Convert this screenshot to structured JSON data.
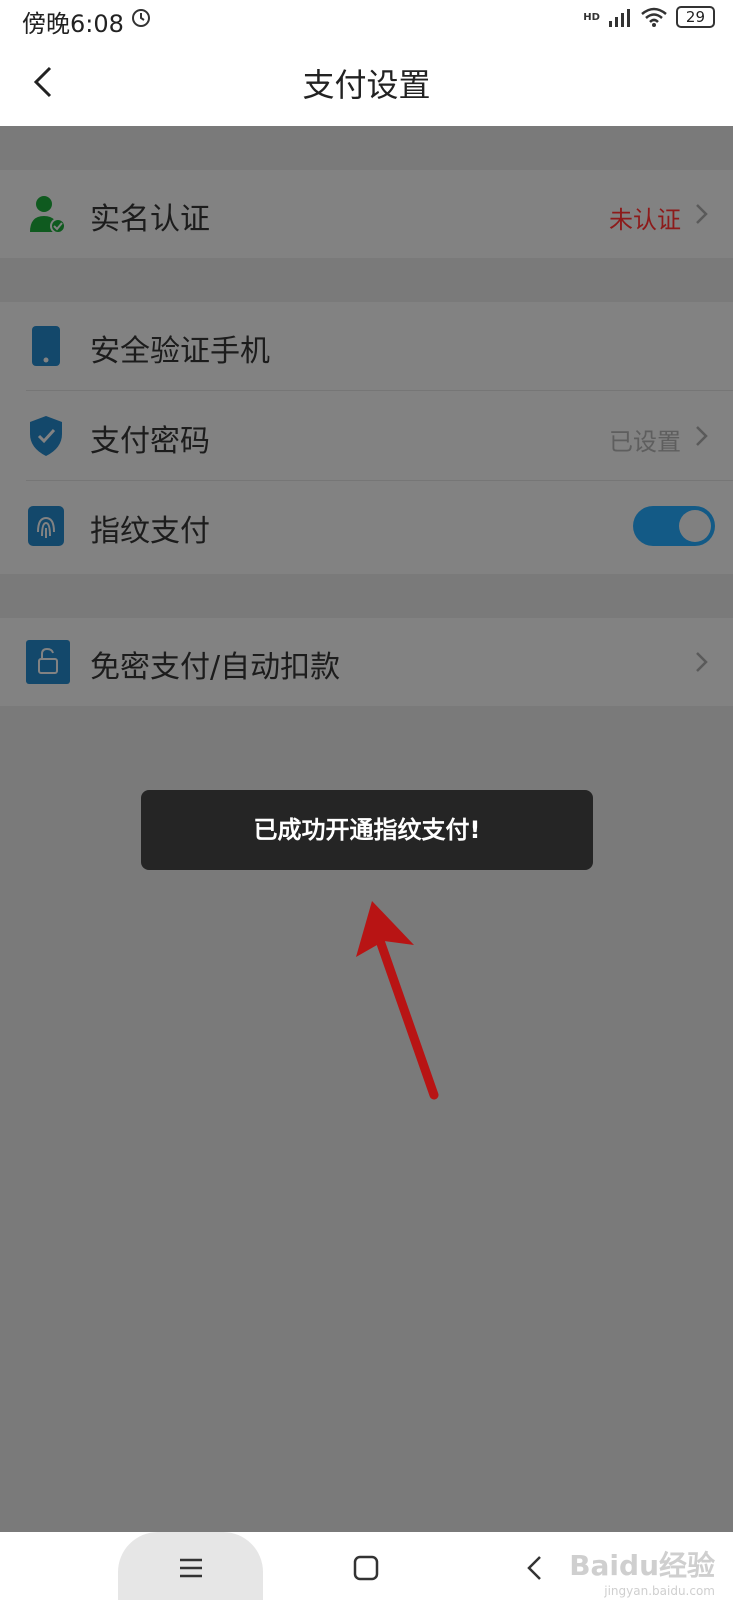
{
  "statusbar": {
    "time": "傍晚6:08",
    "network": "HD",
    "battery": "29"
  },
  "header": {
    "title": "支付设置"
  },
  "groups": [
    {
      "rows": [
        {
          "label": "实名认证",
          "value": "未认证",
          "icon": "user-verified-icon"
        }
      ]
    },
    {
      "rows": [
        {
          "label": "安全验证手机",
          "value": "",
          "icon": "phone-icon"
        },
        {
          "label": "支付密码",
          "value": "已设置",
          "icon": "shield-check-icon"
        },
        {
          "label": "指纹支付",
          "value": "",
          "icon": "fingerprint-icon",
          "toggle": true
        }
      ]
    },
    {
      "rows": [
        {
          "label": "免密支付/自动扣款",
          "value": "",
          "icon": "unlock-icon"
        }
      ]
    }
  ],
  "toast": {
    "message": "已成功开通指纹支付!"
  },
  "watermark": {
    "brand": "Baidu经验",
    "url": "jingyan.baidu.com"
  },
  "colors": {
    "toggle_on": "#135a86",
    "unverified_text": "#8d1a1a"
  }
}
